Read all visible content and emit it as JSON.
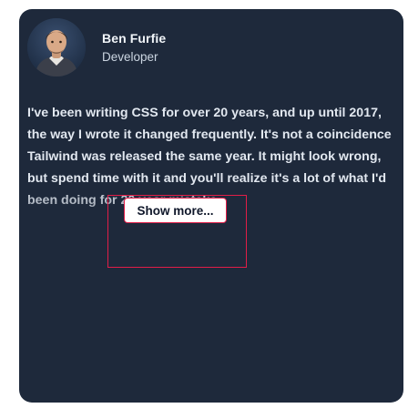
{
  "author": {
    "name": "Ben Furfie",
    "role": "Developer",
    "avatar_icon": "person-photo"
  },
  "testimonial": {
    "text": "I've been writing CSS for over 20 years, and up until 2017, the way I wrote it changed frequently. It's not a coincidence Tailwind was released the same year. It might look wrong, but spend time with it and you'll realize it's a lot of what I'd been doing for 20 year mistake."
  },
  "show_more": {
    "label": "Show more..."
  },
  "colors": {
    "card_background": "#1e293b",
    "highlight_border": "#e11d48"
  }
}
